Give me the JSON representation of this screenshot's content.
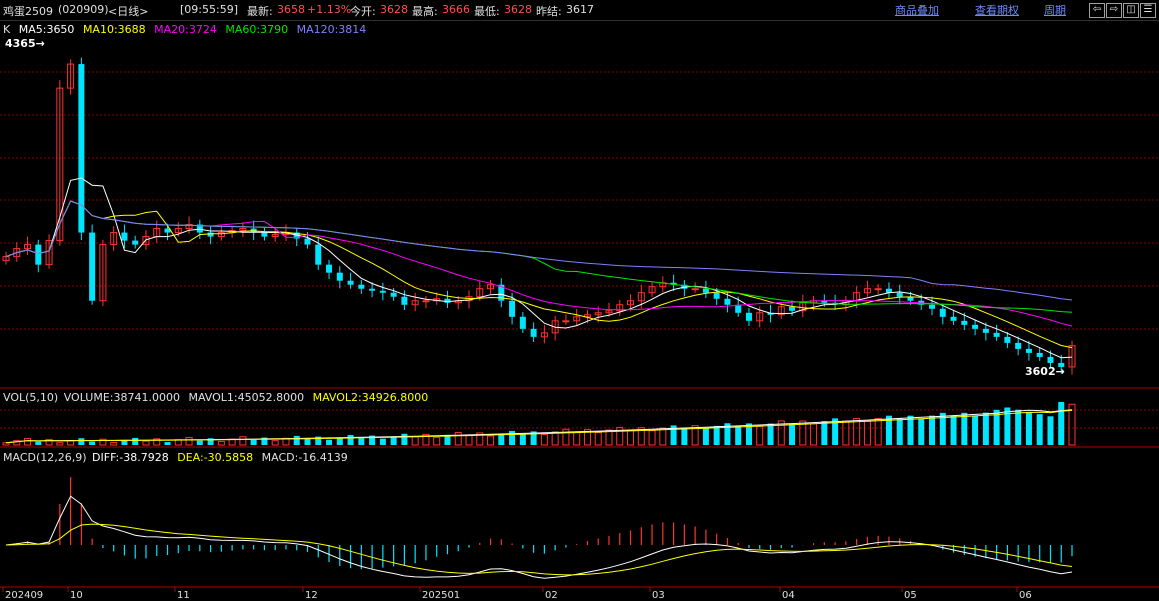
{
  "topbar": {
    "symbol": "鸡蛋2509",
    "code": "(020909)",
    "period": "<日线>",
    "time": "[09:55:59]",
    "last_label": "最新:",
    "last_value": "3658",
    "change": "+1.13%",
    "open_label": "今开:",
    "open_value": "3628",
    "high_label": "最高:",
    "high_value": "3666",
    "low_label": "最低:",
    "low_value": "3628",
    "prev_label": "昨结:",
    "prev_value": "3617",
    "buttons": [
      "商品叠加",
      "查看期权",
      "周期"
    ],
    "nav_icons": [
      "arrow-left-icon",
      "arrow-right-icon",
      "split-icon",
      "menu-icon"
    ]
  },
  "main_legend": {
    "k": "K",
    "ma5": "MA5:3650",
    "ma10": "MA10:3688",
    "ma20": "MA20:3724",
    "ma60": "MA60:3790",
    "ma120": "MA120:3814"
  },
  "vol_legend": {
    "name": "VOL(5,10)",
    "volume": "VOLUME:38741.0000",
    "mavol1": "MAVOL1:45052.8000",
    "mavol2": "MAVOL2:34926.8000"
  },
  "macd_legend": {
    "name": "MACD(12,26,9)",
    "diff": "DIFF:-38.7928",
    "dea": "DEA:-30.5858",
    "macd": "MACD:-16.4139"
  },
  "annotations": {
    "high": "4365→",
    "low": "3602→"
  },
  "colors": {
    "up": "#ff3232",
    "down": "#00e5ff",
    "ma5": "#ffffff",
    "ma10": "#ffff00",
    "ma20": "#ff00ff",
    "ma60": "#00e600",
    "ma120": "#8080ff",
    "grid": "#8b0000",
    "title_red": "#ff5050"
  },
  "chart_data": {
    "type": "candlestick",
    "x_ticks": [
      "202409",
      "10",
      "11",
      "12",
      "202501",
      "02",
      "03",
      "04",
      "05",
      "06"
    ],
    "price": {
      "high_marker": 4365,
      "low_marker": 3602,
      "ylim": [
        3560,
        4420
      ],
      "close_series": [
        3880,
        3900,
        3910,
        3860,
        3920,
        4300,
        4360,
        3940,
        3770,
        3910,
        3940,
        3920,
        3910,
        3930,
        3950,
        3940,
        3950,
        3960,
        3940,
        3930,
        3940,
        3945,
        3950,
        3940,
        3930,
        3935,
        3940,
        3925,
        3910,
        3860,
        3840,
        3820,
        3810,
        3800,
        3795,
        3790,
        3780,
        3760,
        3770,
        3770,
        3775,
        3765,
        3770,
        3780,
        3800,
        3810,
        3770,
        3730,
        3700,
        3680,
        3690,
        3720,
        3720,
        3730,
        3735,
        3740,
        3745,
        3760,
        3770,
        3790,
        3805,
        3815,
        3810,
        3800,
        3800,
        3790,
        3775,
        3760,
        3740,
        3720,
        3740,
        3735,
        3755,
        3745,
        3765,
        3770,
        3765,
        3760,
        3770,
        3790,
        3800,
        3800,
        3790,
        3780,
        3770,
        3760,
        3750,
        3730,
        3720,
        3710,
        3700,
        3690,
        3680,
        3665,
        3650,
        3640,
        3630,
        3615,
        3605,
        3658
      ],
      "ma5": 3650,
      "ma10": 3688,
      "ma20": 3724,
      "ma60": 3790,
      "ma120": 3814
    },
    "volume": {
      "last": 38741,
      "mavol1": 45052.8,
      "mavol2": 34926.8
    },
    "macd": {
      "diff": -38.7928,
      "dea": -30.5858,
      "macd": -16.4139
    }
  }
}
